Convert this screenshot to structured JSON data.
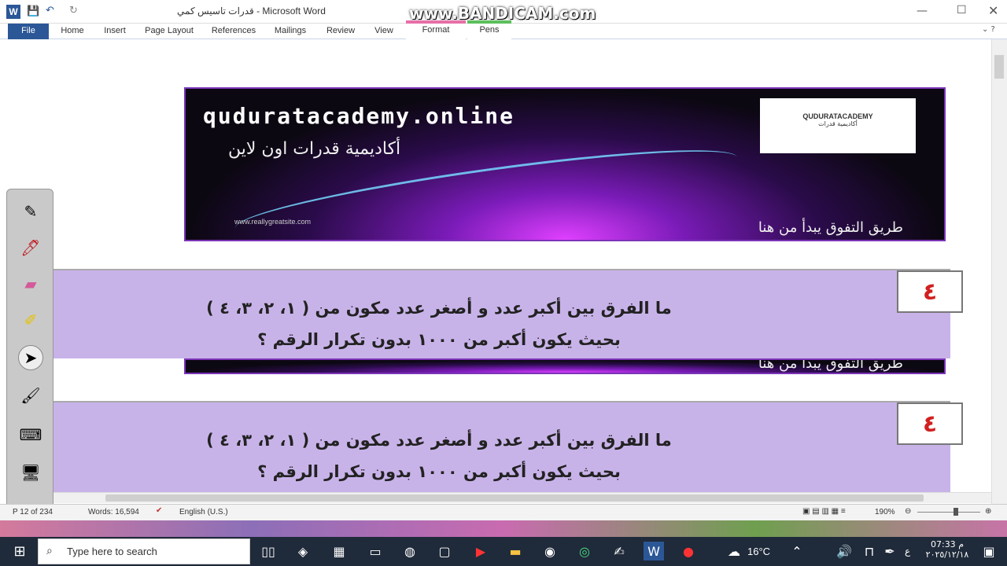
{
  "window": {
    "title": "قدرات تاسيس كمي  -  Microsoft Word",
    "watermark": "www.BANDICAM.com"
  },
  "ribbon": {
    "tabs": [
      "File",
      "Home",
      "Insert",
      "Page Layout",
      "References",
      "Mailings",
      "Review",
      "View"
    ],
    "contextual_tabs": [
      "Format",
      "Pens"
    ]
  },
  "banner": {
    "url": "quduratacademy.online",
    "arabic_name": "أكاديمية قدرات اون لاين",
    "tagline": "طريق التفوق يبدأ من هنا",
    "small_site": "www.reallygreatsite.com",
    "logo_text": "QUDURATACADEMY",
    "logo_subtext": "أكاديمية قدرات"
  },
  "questions": [
    {
      "number": "٤",
      "line1": "ما الفرق بين أكبر  عدد و أصغر عدد مكون من ( ١، ٢، ٣، ٤ )",
      "line2": "بحيث يكون أكبر من ١٠٠٠ بدون تكرار الرقم ؟"
    },
    {
      "number": "٤",
      "line1": "ما الفرق بين أكبر  عدد و أصغر عدد مكون من ( ١، ٢، ٣، ٤ )",
      "line2": "بحيث يكون أكبر من ١٠٠٠ بدون تكرار الرقم ؟"
    }
  ],
  "status": {
    "page": "P 12 of 234",
    "words": "Words: 16,594",
    "language": "English (U.S.)",
    "zoom": "190%"
  },
  "taskbar": {
    "search_placeholder": "Type here to search",
    "temperature": "16°C",
    "time": "07:33 م",
    "date": "٢٠٢٥/١٢/١٨",
    "lang": "ع"
  },
  "colors": {
    "accent": "#2b5797",
    "panel": "#c8b3e9",
    "banner_border": "#7b34b8",
    "number": "#d12020"
  }
}
